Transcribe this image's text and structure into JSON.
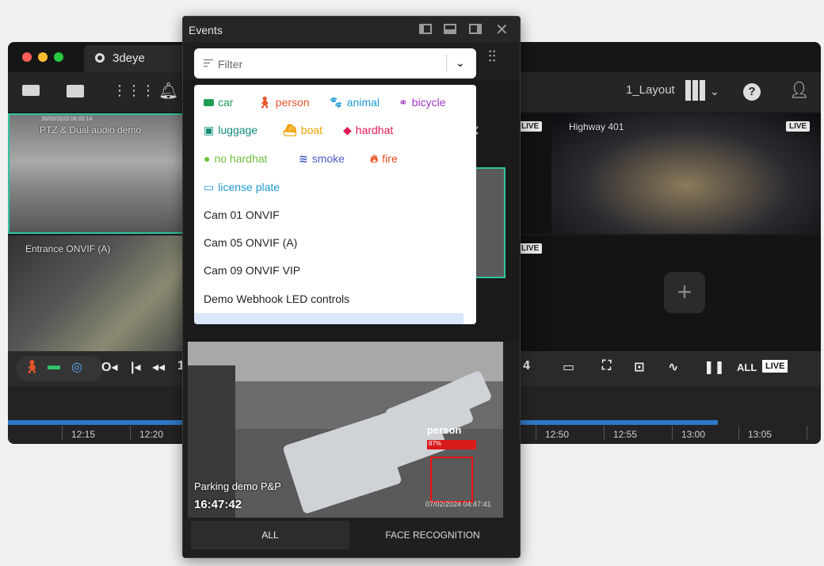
{
  "app": {
    "title": "3deye",
    "layout_name": "1_Layout"
  },
  "tiles": [
    {
      "name": "PTZ & Dual audio demo",
      "overlay_stamp": "26/05/2023 06:02:14"
    },
    {
      "name": "Entrance ONVIF (A)"
    },
    {
      "name": "Highway 401",
      "badge": "LIVE"
    }
  ],
  "tile_badges": {
    "live_left_top": "LIVE",
    "live_left_bottom": "LIVE"
  },
  "controls": {
    "page_number": "4",
    "all_label": "ALL",
    "live_label": "LIVE",
    "left_partial_number": "1"
  },
  "timeline": {
    "labels": [
      "12:15",
      "12:20",
      "12:50",
      "12:55",
      "13:00",
      "13:05"
    ]
  },
  "events_window": {
    "title": "Events",
    "filter_placeholder": "Filter",
    "object_types": [
      {
        "label": "car",
        "color": "#1f9d55",
        "icon": "car-icon"
      },
      {
        "label": "person",
        "color": "#e8542b",
        "icon": "person-icon"
      },
      {
        "label": "animal",
        "color": "#1e9ad6",
        "icon": "paw-icon"
      },
      {
        "label": "bicycle",
        "color": "#a237c9",
        "icon": "bicycle-icon"
      },
      {
        "label": "luggage",
        "color": "#138a7a",
        "icon": "luggage-icon"
      },
      {
        "label": "boat",
        "color": "#f0a000",
        "icon": "boat-icon"
      },
      {
        "label": "hardhat",
        "color": "#e01a4f",
        "icon": "hardhat-icon"
      },
      {
        "label": "no hardhat",
        "color": "#6fbf3c",
        "icon": "no-hardhat-icon"
      },
      {
        "label": "smoke",
        "color": "#4b5bc9",
        "icon": "smoke-icon"
      },
      {
        "label": "fire",
        "color": "#e84a1a",
        "icon": "fire-icon"
      },
      {
        "label": "license plate",
        "color": "#1e9ad6",
        "icon": "license-plate-icon"
      }
    ],
    "cameras": [
      "Cam 01 ONVIF",
      "Cam 05 ONVIF (A)",
      "Cam 09 ONVIF VIP",
      "Demo Webhook LED controls"
    ],
    "event": {
      "camera": "Parking demo P&P",
      "time": "16:47:42",
      "date_stamp": "07/02/2024 04:47:41",
      "detection_label": "person",
      "confidence": "87%"
    },
    "tabs": [
      "ALL",
      "FACE RECOGNITION"
    ]
  }
}
